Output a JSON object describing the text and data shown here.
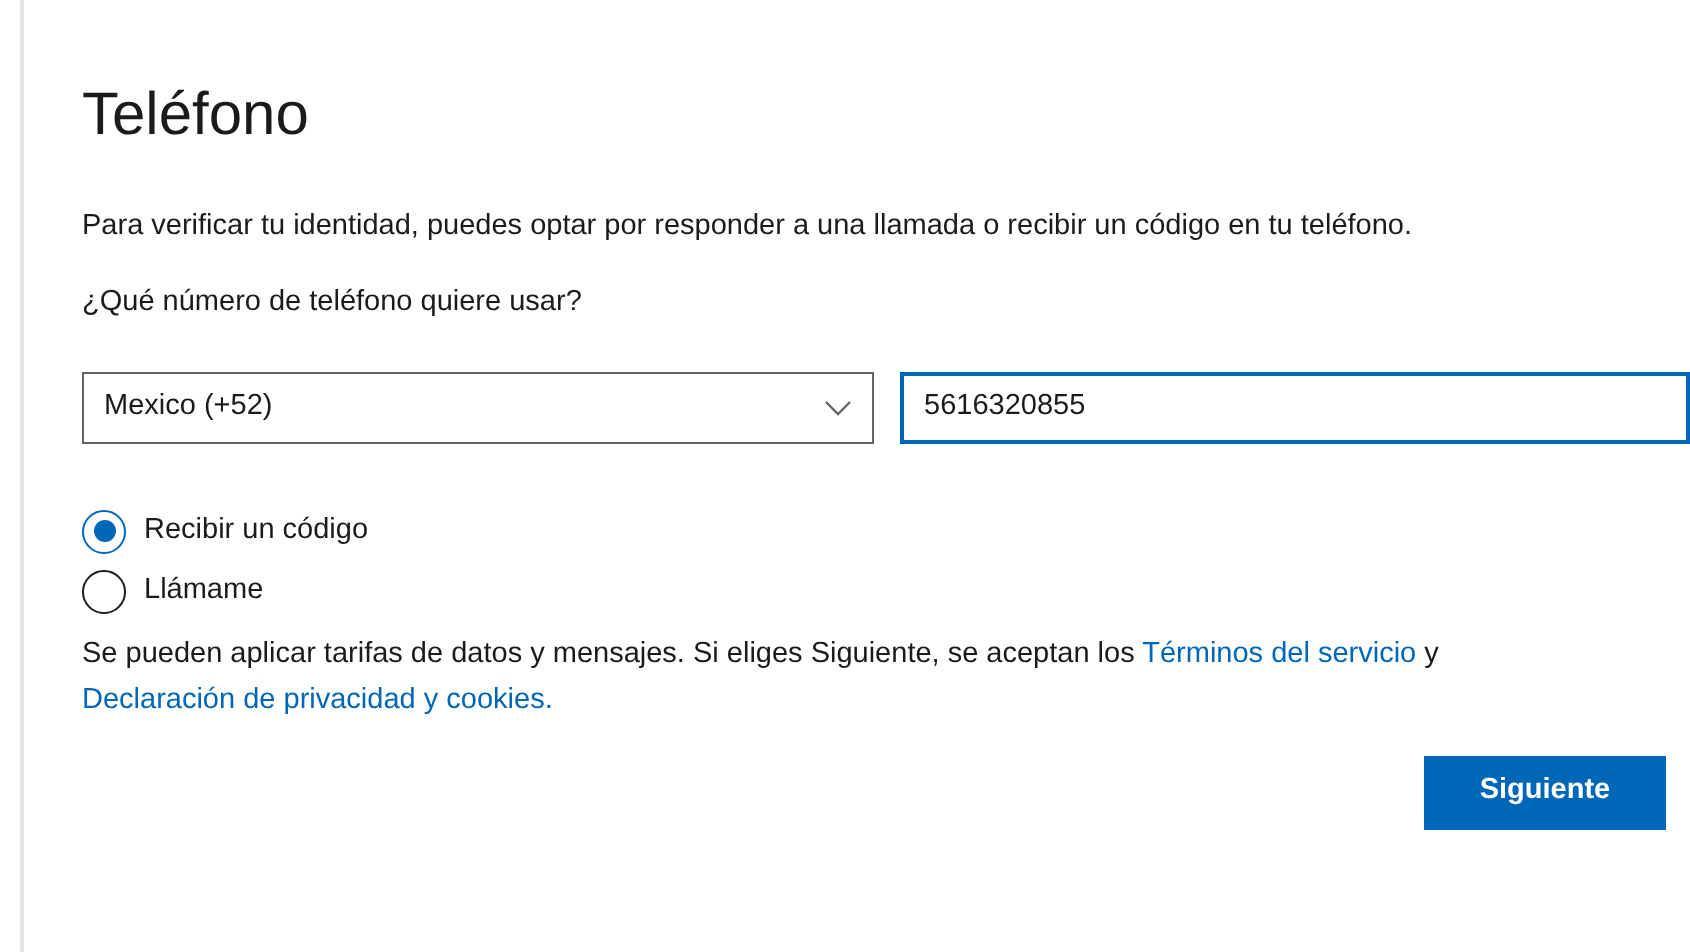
{
  "title": "Teléfono",
  "intro": "Para verificar tu identidad, puedes optar por responder a una llamada o recibir un código en tu teléfono.",
  "question": "¿Qué número de teléfono quiere usar?",
  "country_select": {
    "value": "Mexico (+52)"
  },
  "phone_field": {
    "value": "5616320855",
    "focused": true
  },
  "options": [
    {
      "label": "Recibir un código",
      "selected": true
    },
    {
      "label": "Llámame",
      "selected": false
    }
  ],
  "legal": [
    {
      "kind": "text",
      "text": "Se pueden aplicar tarifas de datos y mensajes. Si eliges Siguiente, se aceptan los "
    },
    {
      "kind": "link",
      "text": "Términos del servicio"
    },
    {
      "kind": "text",
      "text": " y "
    },
    {
      "kind": "link",
      "text": "Declaración de privacidad y cookies."
    }
  ],
  "button": "Siguiente"
}
